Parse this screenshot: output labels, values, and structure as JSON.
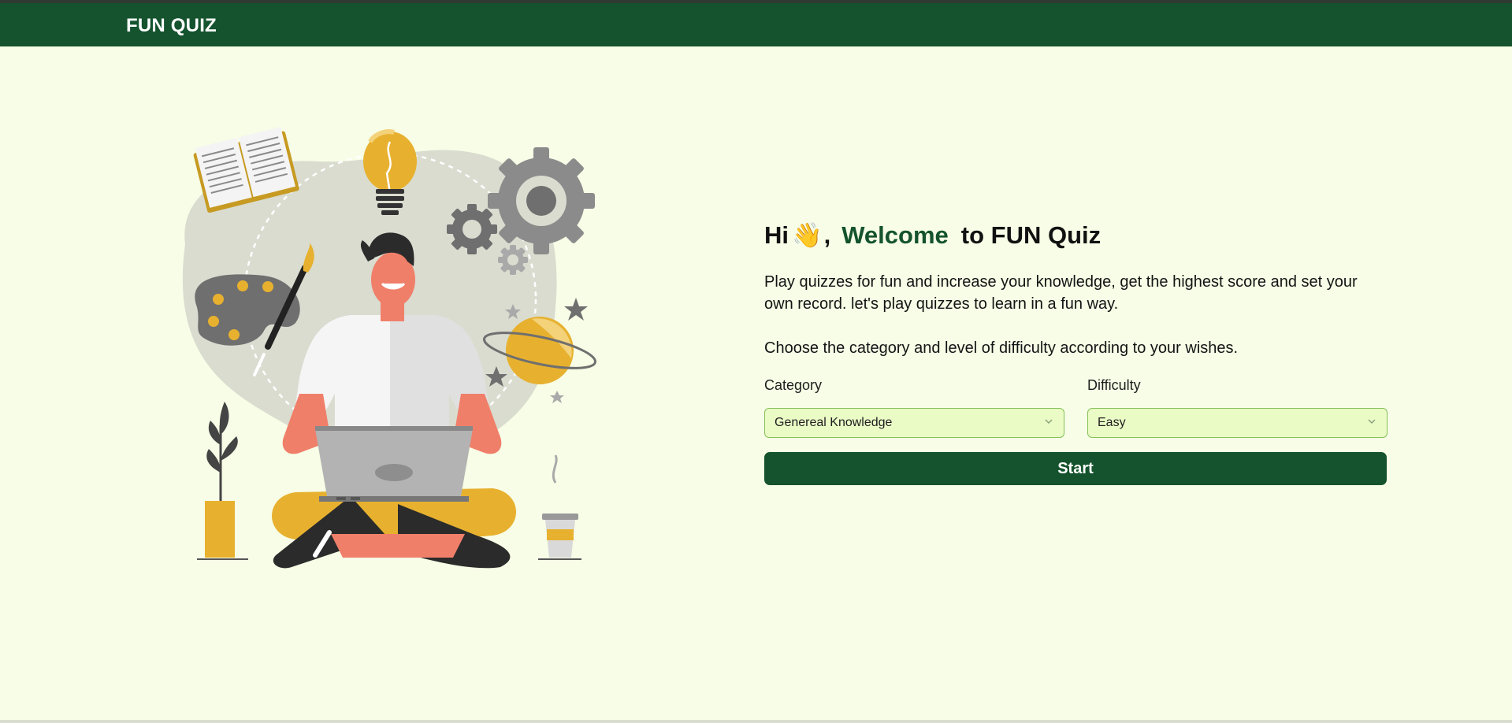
{
  "navbar": {
    "brand": "FUN QUIZ"
  },
  "hero": {
    "greeting": "Hi",
    "wave_emoji": "👋",
    "comma": ",",
    "welcome": "Welcome",
    "title_rest": "to FUN Quiz"
  },
  "description": {
    "paragraph1": "Play quizzes for fun and increase your knowledge, get the highest score and set your own record. let's play quizzes to learn in a fun way.",
    "paragraph2": "Choose the category and level of difficulty according to your wishes."
  },
  "form": {
    "category": {
      "label": "Category",
      "value": "Genereal Knowledge"
    },
    "difficulty": {
      "label": "Difficulty",
      "value": "Easy"
    },
    "start_label": "Start"
  },
  "colors": {
    "brand_green": "#14532d",
    "page_background": "#f7fde6",
    "accent_yellow": "#e7b12f",
    "select_background": "#eafbc6",
    "select_border": "#86c25a"
  },
  "icons": [
    "wave-emoji",
    "chevron-down-icon"
  ]
}
